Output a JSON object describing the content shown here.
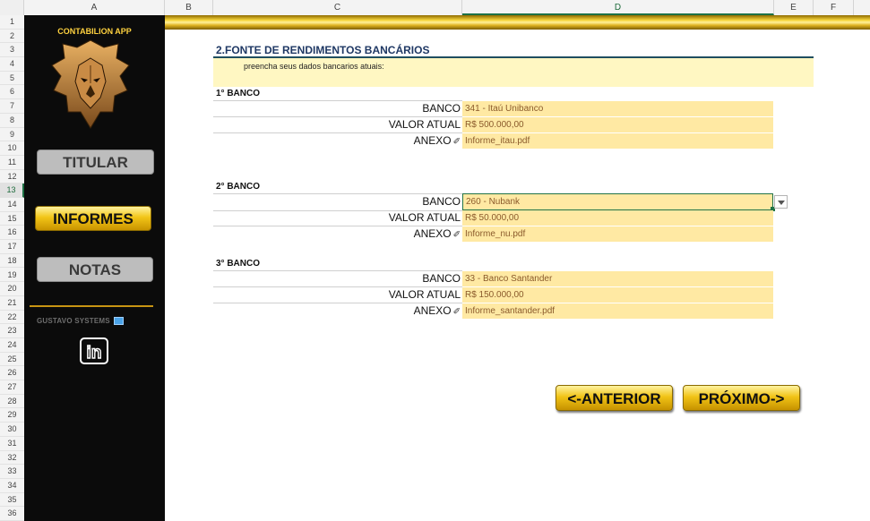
{
  "columns": [
    "A",
    "B",
    "C",
    "D",
    "E",
    "F"
  ],
  "rows": [
    "1",
    "2",
    "3",
    "4",
    "5",
    "6",
    "7",
    "8",
    "9",
    "10",
    "11",
    "12",
    "13",
    "14",
    "15",
    "16",
    "17",
    "18",
    "19",
    "20",
    "21",
    "22",
    "23",
    "24",
    "25",
    "26",
    "27",
    "28",
    "29",
    "30",
    "31",
    "32",
    "33",
    "34",
    "35",
    "36"
  ],
  "selected_row": "13",
  "selected_column": "D",
  "sidebar": {
    "app_title": "CONTABILION APP",
    "nav": [
      {
        "label": "TITULAR",
        "active": false
      },
      {
        "label": "INFORMES",
        "active": true
      },
      {
        "label": "NOTAS",
        "active": false
      }
    ],
    "footer": "GUSTAVO SYSTEMS",
    "linkedin_icon": "linkedin-icon",
    "linkedin_text": "in"
  },
  "main": {
    "title": "2.FONTE DE RENDIMENTOS BANCÁRIOS",
    "hint": "preencha seus dados bancarios atuais:",
    "labels": {
      "bank": "BANCO",
      "value": "VALOR ATUAL",
      "attachment": "ANEXO"
    },
    "banks": [
      {
        "heading": "1° BANCO",
        "bank": "341 - Itaú Unibanco",
        "value": "R$ 500.000,00",
        "attachment": "Informe_itau.pdf"
      },
      {
        "heading": "2° BANCO",
        "bank": "260 - Nubank",
        "value": "R$ 50.000,00",
        "attachment": "Informe_nu.pdf"
      },
      {
        "heading": "3° BANCO",
        "bank": "33 - Banco Santander",
        "value": "R$ 150.000,00",
        "attachment": "Informe_santander.pdf"
      }
    ],
    "attach_glyph": "✐",
    "buttons": {
      "previous": "<-ANTERIOR",
      "next": "PRÓXIMO->"
    }
  },
  "colors": {
    "gold": "#f2c517",
    "sidebar_bg": "#0b0b0b",
    "field_bg": "#ffe9a3",
    "title": "#1f3864",
    "selection": "#217346"
  }
}
